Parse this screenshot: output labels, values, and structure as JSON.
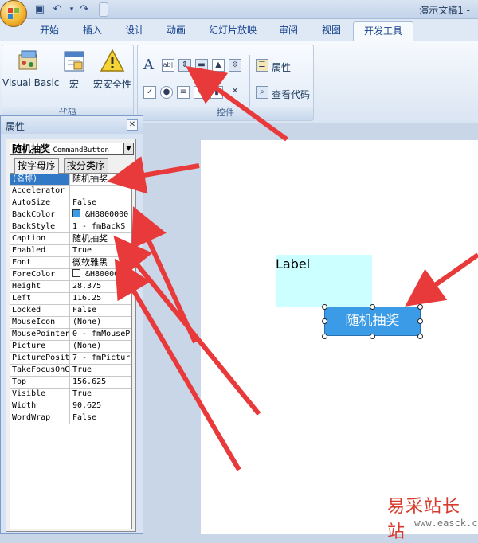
{
  "window": {
    "title": "演示文稿1 -"
  },
  "tabs": [
    "开始",
    "插入",
    "设计",
    "动画",
    "幻灯片放映",
    "审阅",
    "视图"
  ],
  "active_tab": "开发工具",
  "ribbon": {
    "code_group": {
      "label": "代码",
      "visual_basic": "Visual Basic",
      "macros": "宏",
      "macro_security": "宏安全性"
    },
    "controls_group": {
      "label": "控件",
      "properties": "属性",
      "view_code": "查看代码"
    }
  },
  "properties_panel": {
    "title": "属性",
    "object_name": "随机抽奖",
    "object_type": "CommandButton",
    "tabs": {
      "alphabetic": "按字母序",
      "categorized": "按分类序"
    },
    "rows": [
      {
        "name": "(名称)",
        "value": "随机抽奖"
      },
      {
        "name": "Accelerator",
        "value": ""
      },
      {
        "name": "AutoSize",
        "value": "False"
      },
      {
        "name": "BackColor",
        "value": "&H8000000"
      },
      {
        "name": "BackStyle",
        "value": "1 - fmBackS"
      },
      {
        "name": "Caption",
        "value": "随机抽奖"
      },
      {
        "name": "Enabled",
        "value": "True"
      },
      {
        "name": "Font",
        "value": "微软雅黑"
      },
      {
        "name": "ForeColor",
        "value": "&H800000"
      },
      {
        "name": "Height",
        "value": "28.375"
      },
      {
        "name": "Left",
        "value": "116.25"
      },
      {
        "name": "Locked",
        "value": "False"
      },
      {
        "name": "MouseIcon",
        "value": "(None)"
      },
      {
        "name": "MousePointer",
        "value": "0 - fmMouseP"
      },
      {
        "name": "Picture",
        "value": "(None)"
      },
      {
        "name": "PicturePositi",
        "value": "7 - fmPictur"
      },
      {
        "name": "TakeFocusOnCl",
        "value": "True"
      },
      {
        "name": "Top",
        "value": "156.625"
      },
      {
        "name": "Visible",
        "value": "True"
      },
      {
        "name": "Width",
        "value": "90.625"
      },
      {
        "name": "WordWrap",
        "value": "False"
      }
    ]
  },
  "slide": {
    "label_text": "Label",
    "button_text": "随机抽奖"
  },
  "colors": {
    "button_bg": "#3c9be6",
    "label_bg": "#ccffff",
    "arrow": "#e83a3a"
  },
  "watermark": {
    "cn": "易采站长站",
    "url": "www.easck.com"
  }
}
